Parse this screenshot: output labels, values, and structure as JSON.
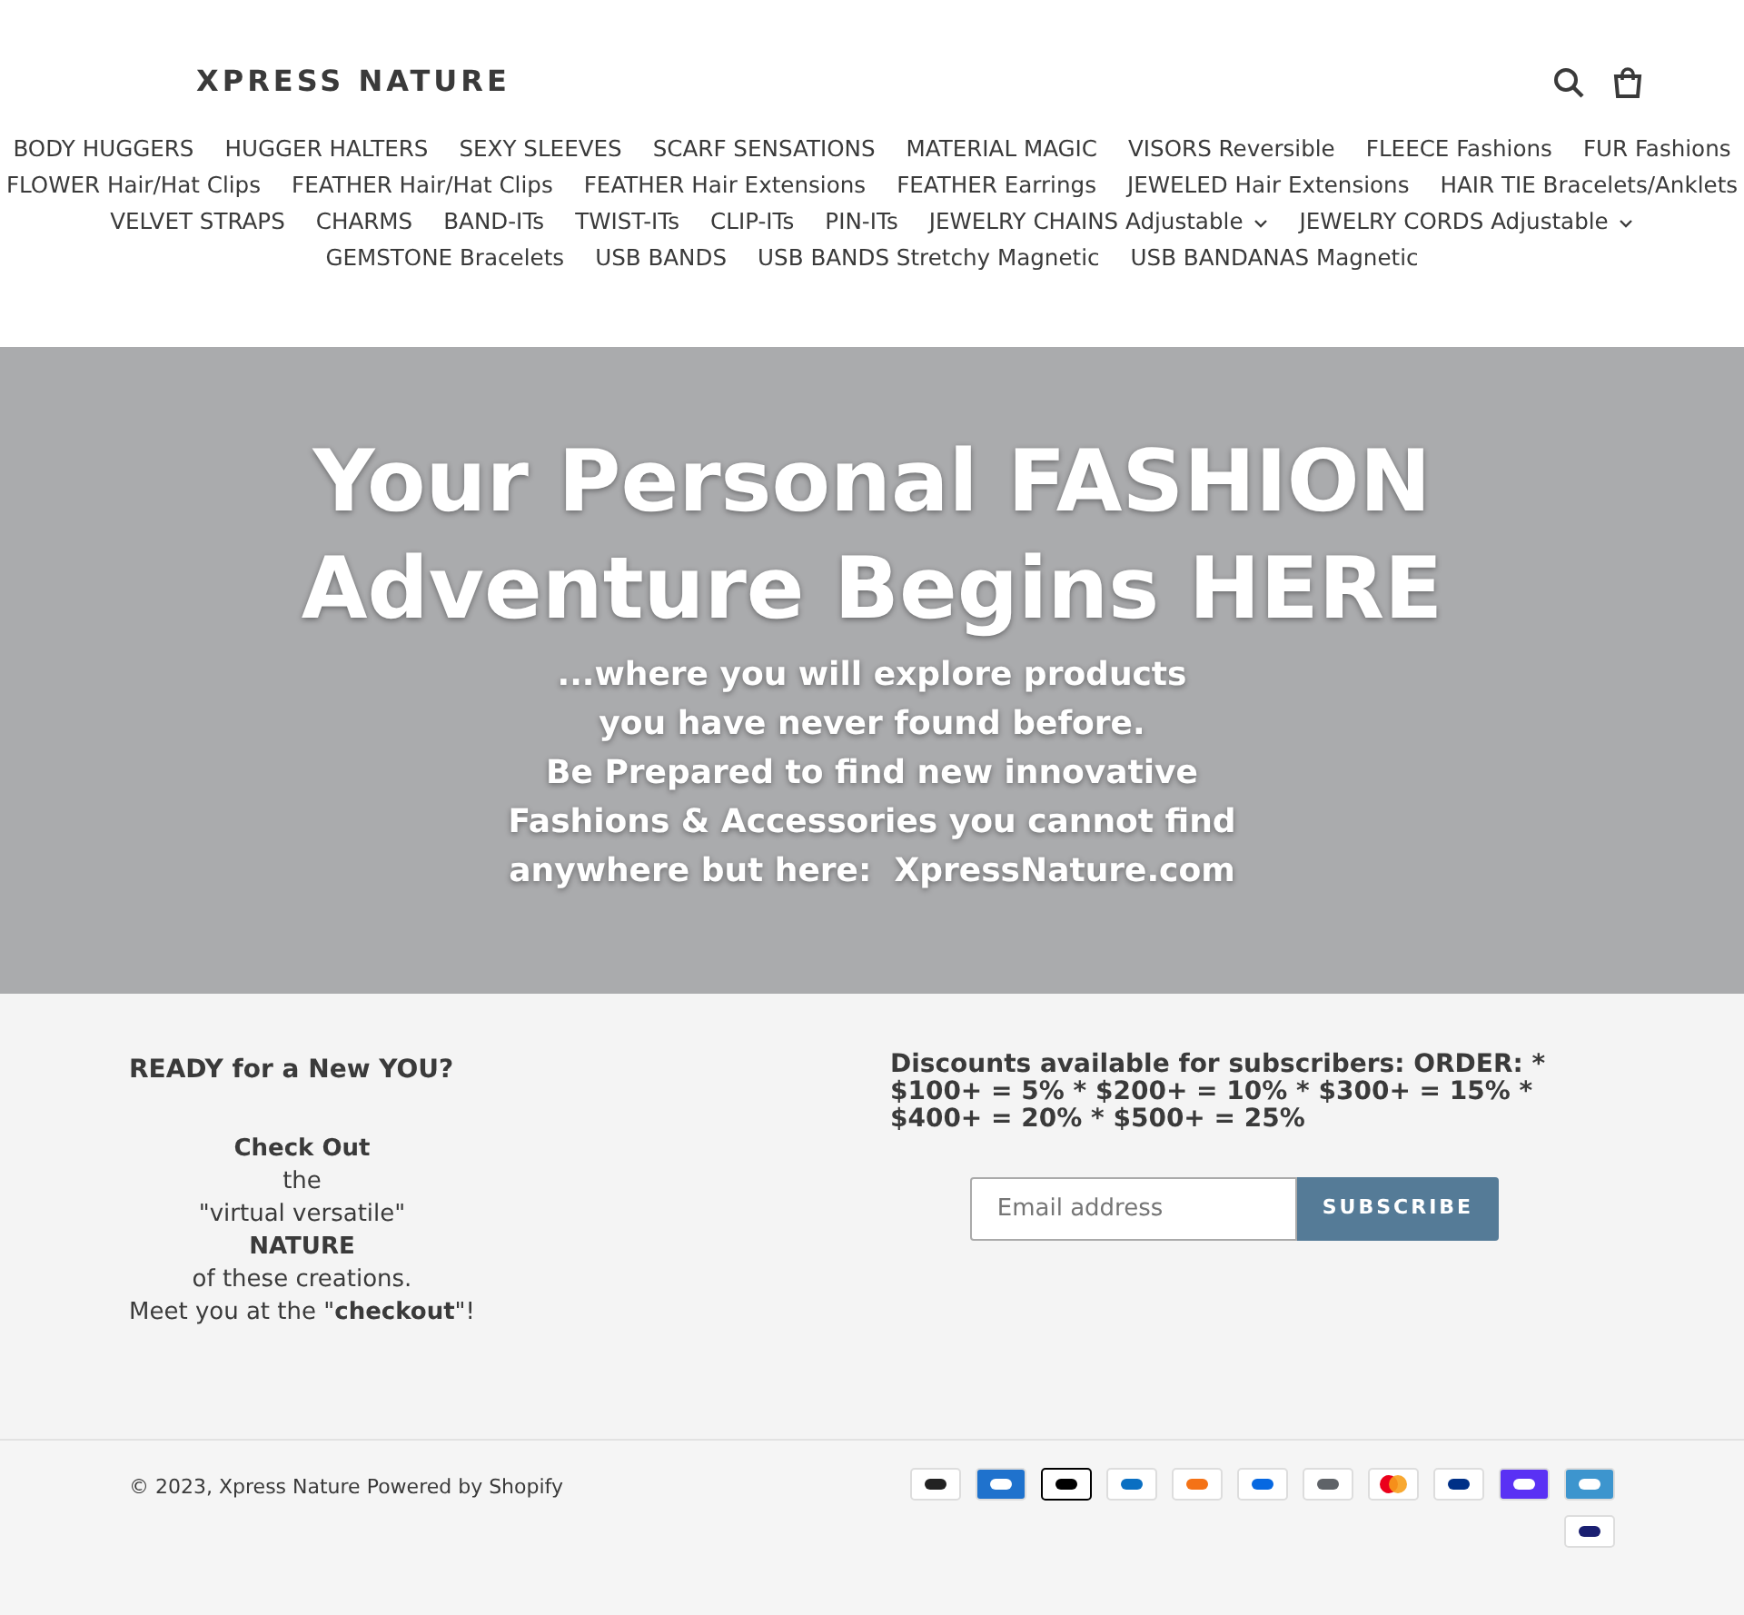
{
  "header": {
    "logo": "XPRESS NATURE"
  },
  "nav": [
    {
      "label": "BODY HUGGERS",
      "has_dropdown": false
    },
    {
      "label": "HUGGER HALTERS",
      "has_dropdown": false
    },
    {
      "label": "SEXY SLEEVES",
      "has_dropdown": false
    },
    {
      "label": "SCARF SENSATIONS",
      "has_dropdown": false
    },
    {
      "label": "MATERIAL MAGIC",
      "has_dropdown": false
    },
    {
      "label": "VISORS Reversible",
      "has_dropdown": false
    },
    {
      "label": "FLEECE Fashions",
      "has_dropdown": false
    },
    {
      "label": "FUR Fashions",
      "has_dropdown": false
    },
    {
      "label": "FLOWER Hair/Hat Clips",
      "has_dropdown": false
    },
    {
      "label": "FEATHER Hair/Hat Clips",
      "has_dropdown": false
    },
    {
      "label": "FEATHER Hair Extensions",
      "has_dropdown": false
    },
    {
      "label": "FEATHER Earrings",
      "has_dropdown": false
    },
    {
      "label": "JEWELED Hair Extensions",
      "has_dropdown": false
    },
    {
      "label": "HAIR TIE Bracelets/Anklets",
      "has_dropdown": false
    },
    {
      "label": "VELVET STRAPS",
      "has_dropdown": false
    },
    {
      "label": "CHARMS",
      "has_dropdown": false
    },
    {
      "label": "BAND-ITs",
      "has_dropdown": false
    },
    {
      "label": "TWIST-ITs",
      "has_dropdown": false
    },
    {
      "label": "CLIP-ITs",
      "has_dropdown": false
    },
    {
      "label": "PIN-ITs",
      "has_dropdown": false
    },
    {
      "label": "JEWELRY CHAINS Adjustable",
      "has_dropdown": true
    },
    {
      "label": "JEWELRY CORDS Adjustable",
      "has_dropdown": true
    },
    {
      "label": "GEMSTONE Bracelets",
      "has_dropdown": false
    },
    {
      "label": "USB BANDS",
      "has_dropdown": false
    },
    {
      "label": "USB BANDS Stretchy Magnetic",
      "has_dropdown": false
    },
    {
      "label": "USB BANDANAS Magnetic",
      "has_dropdown": false
    }
  ],
  "hero": {
    "title": "Your Personal FASHION Adventure Begins HERE",
    "subtitle_lines": [
      "...where you will explore products",
      "you have never found before.",
      "Be Prepared to find new innovative",
      "Fashions & Accessories you cannot find",
      "anywhere but here:  XpressNature.com"
    ]
  },
  "footer": {
    "heading": "READY for a New YOU?",
    "lines": [
      "**Check Out**",
      "the",
      "\"virtual versatile\"",
      "**NATURE**",
      "of these creations.",
      "Meet you at the \"**checkout**\"!"
    ],
    "newsletter_heading": "Discounts available for subscribers: ORDER: * $100+ = 5% * $200+ = 10% * $300+ = 15% * $400+ = 20% * $500+ = 25%",
    "email": {
      "placeholder": "Email address"
    },
    "subscribe_button": "SUBSCRIBE"
  },
  "bottom": {
    "copyright": "© 2023,",
    "store_link": "Xpress Nature",
    "powered_by": "Powered by Shopify"
  }
}
